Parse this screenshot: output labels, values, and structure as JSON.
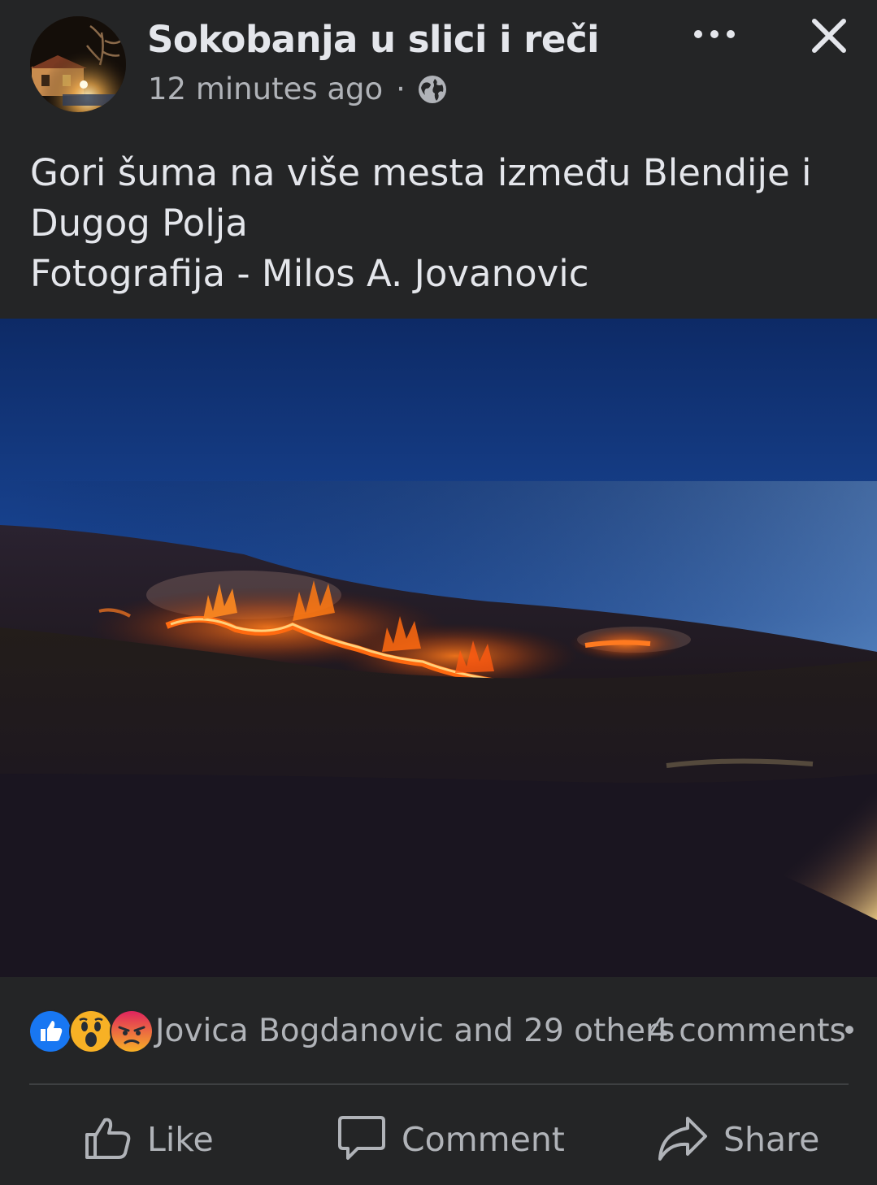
{
  "post": {
    "page_name": "Sokobanja u slici i reči",
    "time_ago": "12 minutes ago",
    "separator": "·",
    "audience_icon": "globe-icon",
    "caption_lines": [
      "Gori šuma na više mesta između Blendije i",
      "Dugog Polja",
      "Fotografija - Milos A. Jovanovic"
    ]
  },
  "header_actions": {
    "more_icon": "more-horizontal-icon",
    "close_icon": "close-icon"
  },
  "engagement": {
    "reaction_icons": [
      "like-reaction-icon",
      "wow-reaction-icon",
      "angry-reaction-icon"
    ],
    "reactors_text": "Jovica Bogdanovic and 29 others",
    "comments_text": "4 comments"
  },
  "actions": {
    "like_label": "Like",
    "comment_label": "Comment",
    "share_label": "Share"
  },
  "colors": {
    "background": "#242526",
    "primary_text": "#e4e6eb",
    "secondary_text": "#b0b3b8",
    "like_blue": "#1877f2",
    "reaction_yellow": "#f7b125",
    "angry_orange": "#e9710f"
  }
}
